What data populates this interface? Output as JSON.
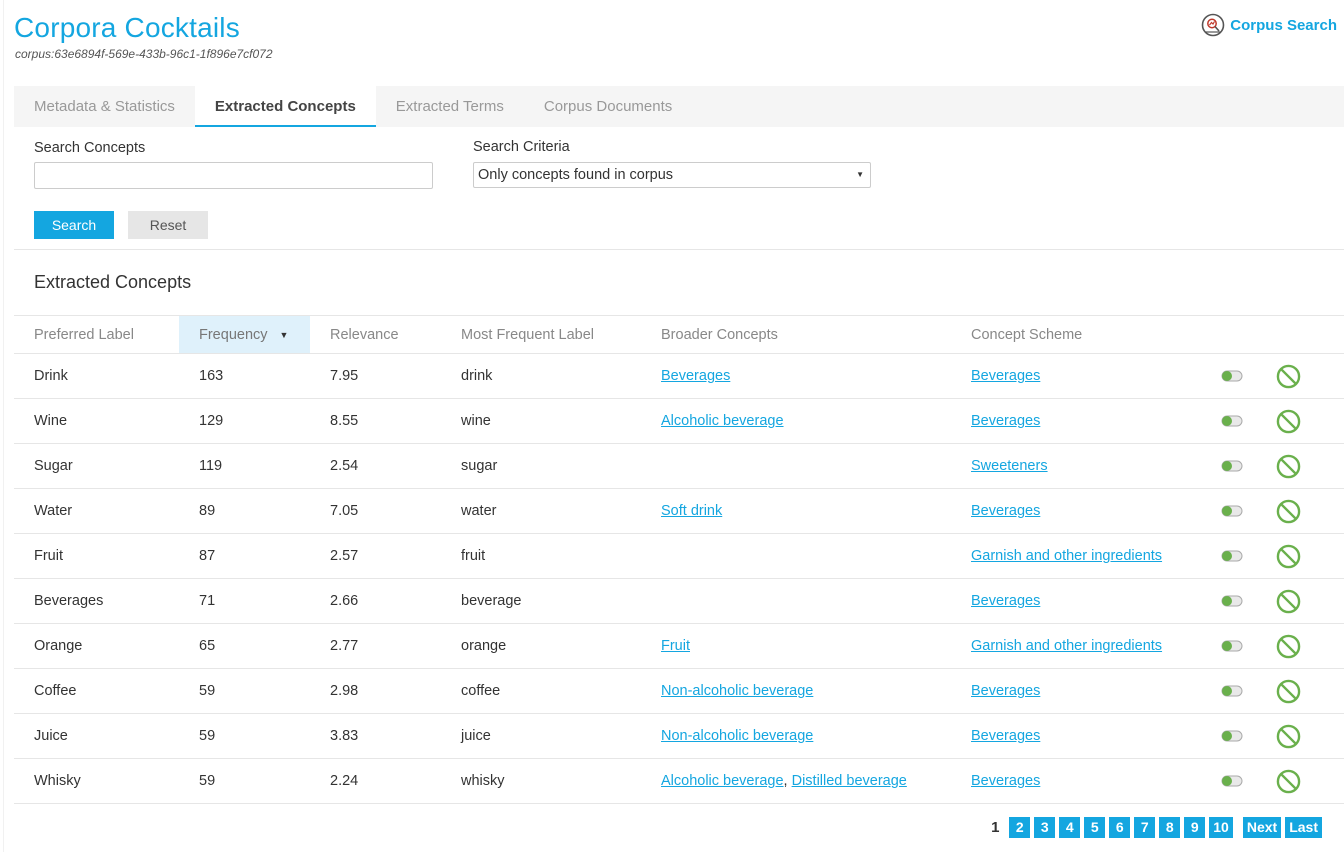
{
  "header": {
    "title": "Corpora Cocktails",
    "corpus_id": "corpus:63e6894f-569e-433b-96c1-1f896e7cf072",
    "corpus_search_label": "Corpus Search",
    "corpus_search_icon": "chart-search-icon"
  },
  "tabs": [
    {
      "label": "Metadata & Statistics",
      "active": false
    },
    {
      "label": "Extracted Concepts",
      "active": true
    },
    {
      "label": "Extracted Terms",
      "active": false
    },
    {
      "label": "Corpus Documents",
      "active": false
    }
  ],
  "search": {
    "concepts_label": "Search Concepts",
    "concepts_value": "",
    "criteria_label": "Search Criteria",
    "criteria_selected": "Only concepts found in corpus",
    "search_button": "Search",
    "reset_button": "Reset"
  },
  "section_title": "Extracted Concepts",
  "table": {
    "columns": [
      "Preferred Label",
      "Frequency",
      "Relevance",
      "Most Frequent Label",
      "Broader Concepts",
      "Concept Scheme"
    ],
    "sorted_column": "Frequency",
    "rows": [
      {
        "preferred": "Drink",
        "frequency": "163",
        "relevance": "7.95",
        "most_frequent": "drink",
        "broader": [
          "Beverages"
        ],
        "scheme": "Beverages"
      },
      {
        "preferred": "Wine",
        "frequency": "129",
        "relevance": "8.55",
        "most_frequent": "wine",
        "broader": [
          "Alcoholic beverage"
        ],
        "scheme": "Beverages"
      },
      {
        "preferred": "Sugar",
        "frequency": "119",
        "relevance": "2.54",
        "most_frequent": "sugar",
        "broader": [],
        "scheme": "Sweeteners"
      },
      {
        "preferred": "Water",
        "frequency": "89",
        "relevance": "7.05",
        "most_frequent": "water",
        "broader": [
          "Soft drink"
        ],
        "scheme": "Beverages"
      },
      {
        "preferred": "Fruit",
        "frequency": "87",
        "relevance": "2.57",
        "most_frequent": "fruit",
        "broader": [],
        "scheme": "Garnish and other ingredients"
      },
      {
        "preferred": "Beverages",
        "frequency": "71",
        "relevance": "2.66",
        "most_frequent": "beverage",
        "broader": [],
        "scheme": "Beverages"
      },
      {
        "preferred": "Orange",
        "frequency": "65",
        "relevance": "2.77",
        "most_frequent": "orange",
        "broader": [
          "Fruit"
        ],
        "scheme": "Garnish and other ingredients"
      },
      {
        "preferred": "Coffee",
        "frequency": "59",
        "relevance": "2.98",
        "most_frequent": "coffee",
        "broader": [
          "Non-alcoholic beverage"
        ],
        "scheme": "Beverages"
      },
      {
        "preferred": "Juice",
        "frequency": "59",
        "relevance": "3.83",
        "most_frequent": "juice",
        "broader": [
          "Non-alcoholic beverage"
        ],
        "scheme": "Beverages"
      },
      {
        "preferred": "Whisky",
        "frequency": "59",
        "relevance": "2.24",
        "most_frequent": "whisky",
        "broader": [
          "Alcoholic beverage",
          "Distilled beverage"
        ],
        "scheme": "Beverages"
      }
    ]
  },
  "pagination": {
    "current": "1",
    "pages": [
      "2",
      "3",
      "4",
      "5",
      "6",
      "7",
      "8",
      "9",
      "10"
    ],
    "next": "Next",
    "last": "Last"
  },
  "colors": {
    "accent": "#14a6e0",
    "toggle": "#6ab04c",
    "ban": "#6ab04c"
  }
}
